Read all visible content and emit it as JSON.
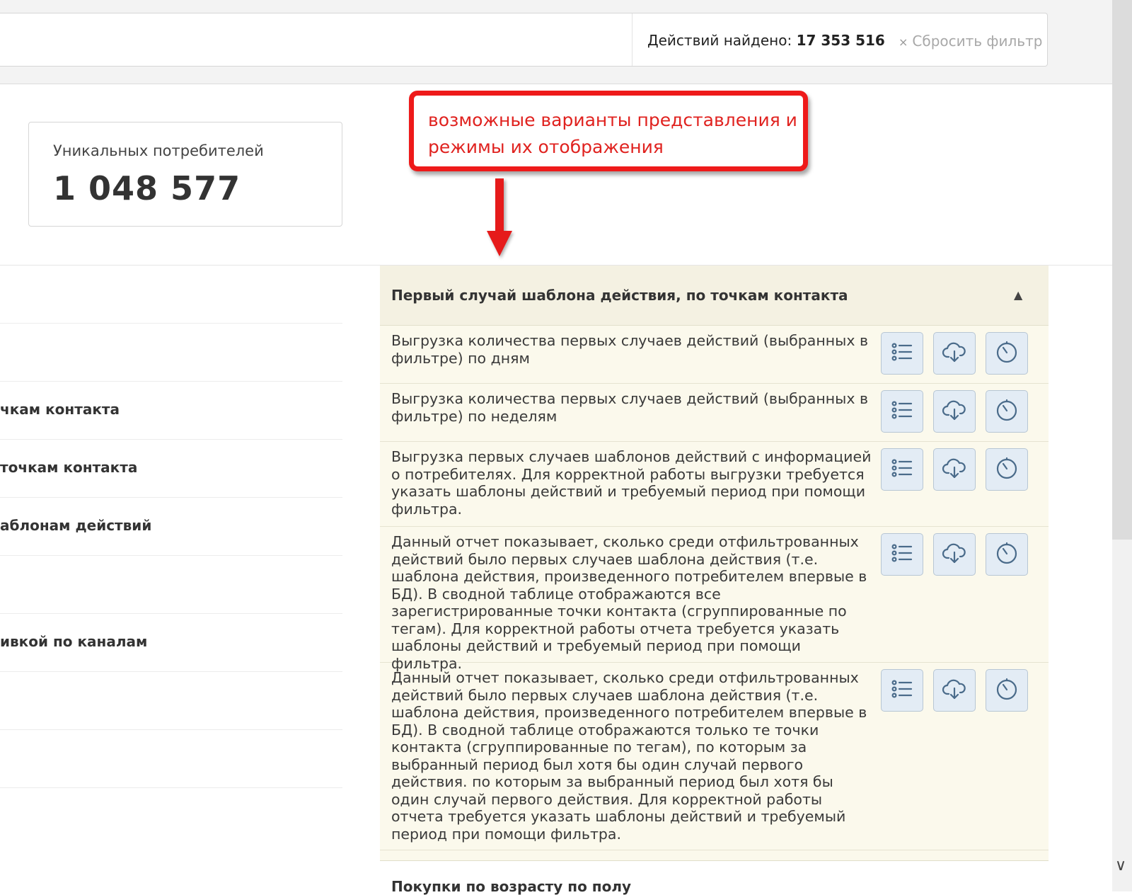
{
  "filter_bar": {
    "found_label": "Действий найдено:",
    "found_value": "17 353 516",
    "reset_x": "×",
    "reset_label": "Сбросить фильтр"
  },
  "unique_card": {
    "label": "Уникальных потребителей",
    "value": "1 048 577"
  },
  "left_list": [
    "",
    "",
    "чкам контакта",
    " точкам контакта",
    "аблонам действий",
    "",
    "ивкой по каналам",
    "",
    ""
  ],
  "annotation": {
    "text": "возможные варианты представления и режимы их отображения"
  },
  "panel": {
    "title": "Первый случай шаблона действия, по точкам контакта",
    "collapse_glyph": "▲",
    "rows": [
      {
        "text": "Выгрузка количества первых случаев действий (выбранных в фильтре) по дням"
      },
      {
        "text": "Выгрузка количества первых случаев действий (выбранных в фильтре) по неделям"
      },
      {
        "text": "Выгрузка первых случаев шаблонов действий с информацией о потребителях. Для корректной работы выгрузки требуется указать шаблоны действий и требуемый период при помощи фильтра."
      },
      {
        "text": "Данный отчет показывает, сколько среди отфильтрованных действий было первых случаев шаблона действия (т.е. шаблона действия, произведенного потребителем впервые в БД). В сводной таблице отображаются все зарегистрированные точки контакта (сгруппированные по тегам). Для корректной работы отчета требуется указать шаблоны действий и требуемый период при помощи фильтра."
      },
      {
        "text": "Данный отчет показывает, сколько среди отфильтрованных действий было первых случаев шаблона действия (т.е. шаблона действия, произведенного потребителем впервые в БД). В сводной таблице отображаются только те точки контакта (сгруппированные по тегам), по которым за выбранный период был хотя бы один случай первого действия. по которым за выбранный период был хотя бы один случай первого действия. Для корректной работы отчета требуется указать шаблоны действий и требуемый период при помощи фильтра."
      }
    ]
  },
  "next_section_title": "Покупки по возрасту по полу",
  "icons": {
    "list": "list-icon",
    "download": "cloud-download-icon",
    "schedule": "timer-icon"
  },
  "colors": {
    "annotation": "#ee1a1a",
    "panel_bg": "#fbf9ec",
    "button_bg": "#e3ecf5",
    "button_icon": "#4a6b8a"
  }
}
